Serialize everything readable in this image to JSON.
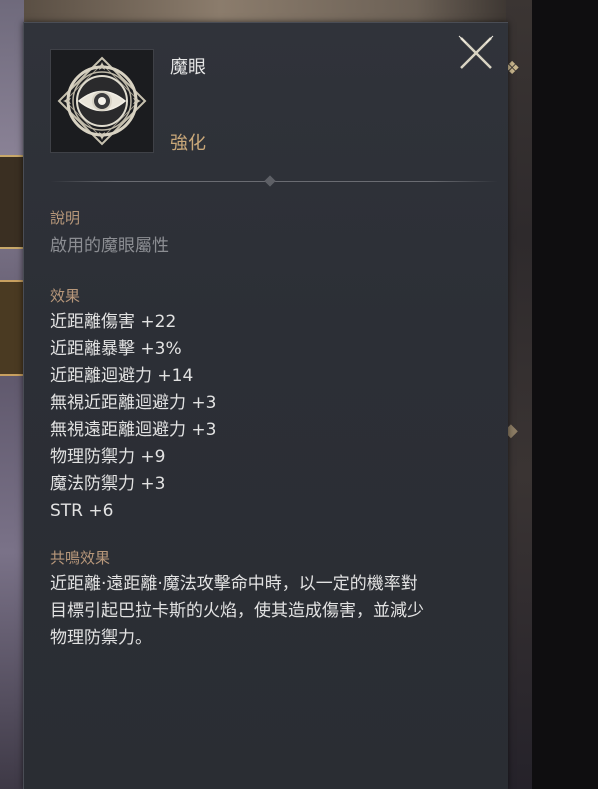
{
  "item": {
    "name": "魔眼",
    "type": "強化",
    "icon": "eye-emblem-icon"
  },
  "description": {
    "label": "說明",
    "text": "啟用的魔眼屬性"
  },
  "effects": {
    "label": "效果",
    "items": [
      "近距離傷害 +22",
      "近距離暴擊 +3%",
      "近距離迴避力 +14",
      "無視近距離迴避力 +3",
      "無視遠距離迴避力 +3",
      "物理防禦力 +9",
      "魔法防禦力 +3",
      "STR +6"
    ]
  },
  "resonance": {
    "label": "共鳴效果",
    "lines": [
      "近距離‧遠距離‧魔法攻擊命中時，以一定的機率對",
      "目標引起巴拉卡斯的火焰，使其造成傷害，並減少",
      "物理防禦力。"
    ]
  },
  "colors": {
    "accent_gold": "#c9a879",
    "section_label": "#b7977a",
    "panel_bg": "#2c2f36"
  }
}
